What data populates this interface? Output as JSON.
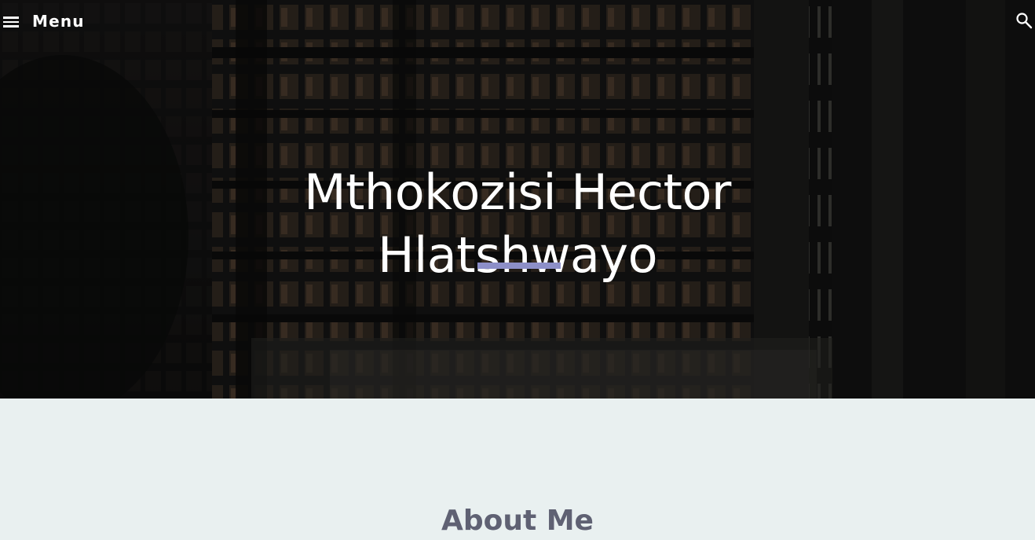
{
  "header": {
    "menu_label": "Menu",
    "menu_icon": "hamburger-menu-icon",
    "search_icon": "search-icon"
  },
  "hero": {
    "title_line1": "Mthokozisi Hector",
    "title_line2": "Hlatshwayo",
    "underline_color": "#8d8fc8"
  },
  "about": {
    "heading": "About Me",
    "background_color": "#e9f0f0",
    "heading_color": "#5f6173"
  }
}
